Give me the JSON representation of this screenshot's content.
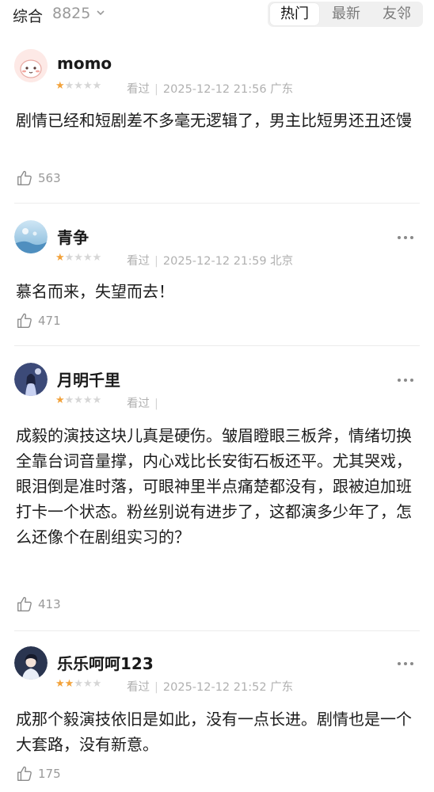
{
  "header": {
    "summary_label": "综合",
    "summary_count": "8825",
    "tabs": [
      {
        "label": "热门",
        "active": true
      },
      {
        "label": "最新",
        "active": false
      },
      {
        "label": "友邻",
        "active": false
      }
    ]
  },
  "comments": [
    {
      "username": "momo",
      "rating": 1,
      "watched": "看过",
      "datetime": "2025-12-12 21:56",
      "location": "广东",
      "text": "剧情已经和短剧差不多毫无逻辑了，男主比短男还丑还馒",
      "likes": "563",
      "avatar_icon": "pink-character-avatar"
    },
    {
      "username": "青争",
      "rating": 1,
      "watched": "看过",
      "datetime": "2025-12-12 21:59",
      "location": "北京",
      "text": "慕名而来，失望而去！",
      "likes": "471",
      "avatar_icon": "blue-scenery-avatar"
    },
    {
      "username": "月明千里",
      "rating": 1,
      "watched": "看过",
      "datetime": "",
      "location": "",
      "text": "成毅的演技这块儿真是硬伤。皱眉瞪眼三板斧，情绪切换全靠台词音量撑，内心戏比长安街石板还平。尤其哭戏，眼泪倒是准时落，可眼神里半点痛楚都没有，跟被迫加班打卡一个状态。粉丝别说有进步了，这都演多少年了，怎么还像个在剧组实习的？",
      "likes": "413",
      "avatar_icon": "night-figure-avatar"
    },
    {
      "username": "乐乐呵呵123",
      "rating": 2,
      "watched": "看过",
      "datetime": "2025-12-12 21:52",
      "location": "广东",
      "text": "成那个毅演技依旧是如此，没有一点长进。剧情也是一个大套路，没有新意。",
      "likes": "175",
      "avatar_icon": "anime-boy-avatar"
    }
  ],
  "colors": {
    "star_on": "#f2a23b",
    "star_off": "#d6d6d6",
    "meta_text": "#b0b0b0"
  }
}
